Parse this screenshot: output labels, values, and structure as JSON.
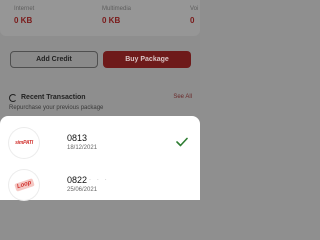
{
  "stats": [
    {
      "label": "Internet",
      "value": "0 KB"
    },
    {
      "label": "Multimedia",
      "value": "0 KB"
    },
    {
      "label": "Voi",
      "value": "0"
    }
  ],
  "actions": {
    "add_credit": "Add Credit",
    "buy_package": "Buy Package"
  },
  "recent": {
    "title": "Recent Transaction",
    "see_all": "See All",
    "subtitle": "Repurchase your previous package"
  },
  "sheet": {
    "numbers": [
      {
        "logo": "simPATI",
        "number": "0813",
        "date": "18/12/2021",
        "selected": true
      },
      {
        "logo": "Loop",
        "number": "0822",
        "masked": ". . .",
        "date": "25/06/2021",
        "selected": false
      }
    ]
  },
  "colors": {
    "accent": "#d0312d",
    "check": "#2e7d32"
  },
  "icons": [
    "refresh-icon",
    "check-icon"
  ]
}
